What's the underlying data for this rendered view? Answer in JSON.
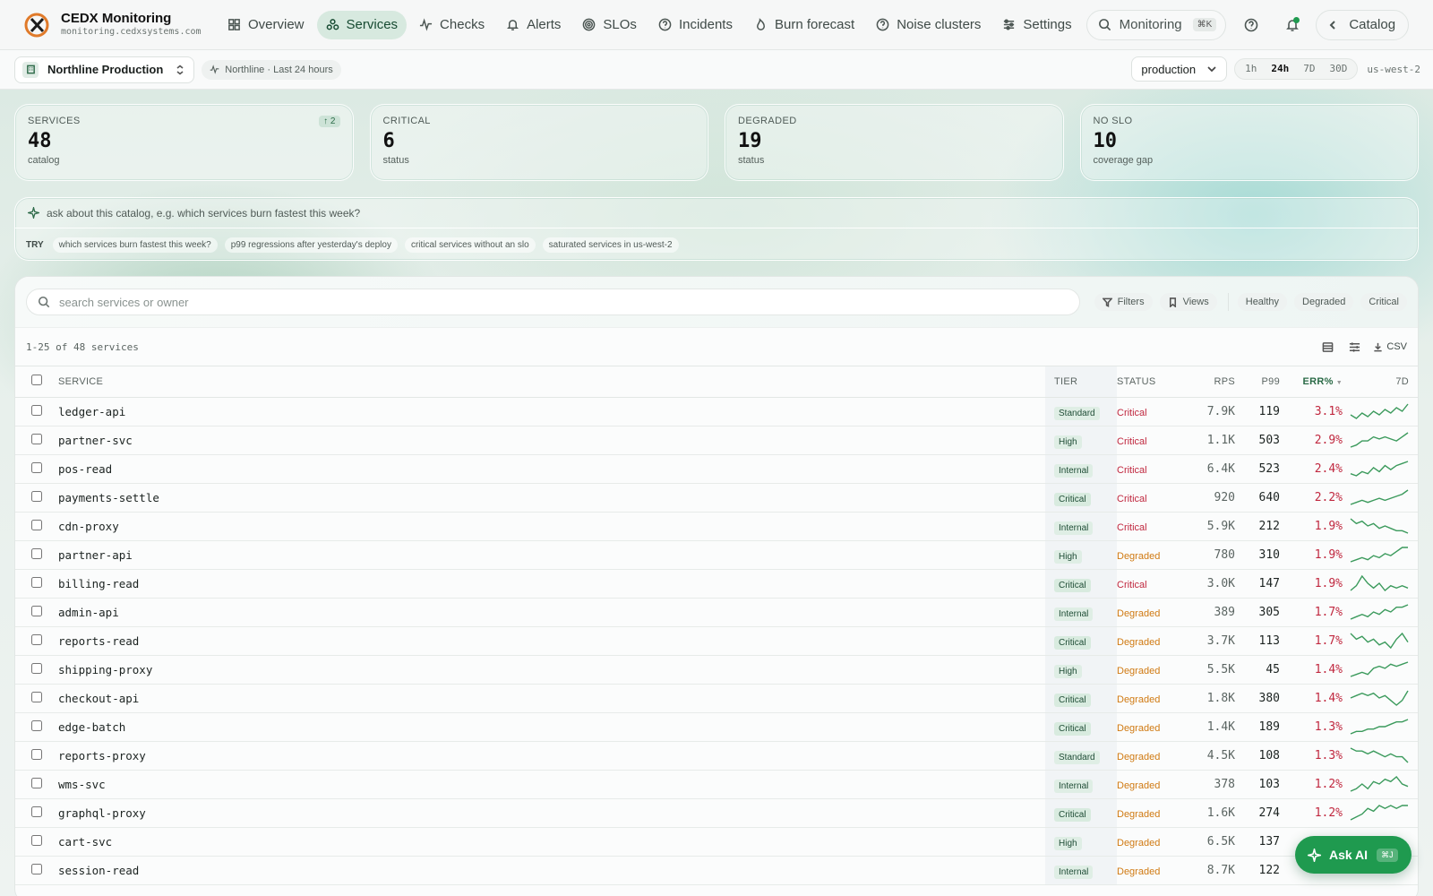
{
  "brand": {
    "title": "CEDX Monitoring",
    "domain": "monitoring.cedxsystems.com"
  },
  "nav": [
    {
      "label": "Overview",
      "icon": "grid-icon"
    },
    {
      "label": "Services",
      "icon": "cluster-icon",
      "active": true
    },
    {
      "label": "Checks",
      "icon": "pulse-icon"
    },
    {
      "label": "Alerts",
      "icon": "bell-icon"
    },
    {
      "label": "SLOs",
      "icon": "target-icon"
    },
    {
      "label": "Incidents",
      "icon": "help-circle-icon"
    },
    {
      "label": "Burn forecast",
      "icon": "flame-icon"
    },
    {
      "label": "Noise clusters",
      "icon": "help-circle-icon"
    },
    {
      "label": "Settings",
      "icon": "sliders-icon"
    }
  ],
  "search": {
    "label": "Monitoring",
    "shortcut": "⌘K"
  },
  "catalog_button": "Catalog",
  "subbar": {
    "org": "Northline Production",
    "context": "Northline · Last 24 hours",
    "environment": "production",
    "ranges": [
      "1h",
      "24h",
      "7D",
      "30D"
    ],
    "active_range": "24h",
    "region": "us-west-2"
  },
  "stats": [
    {
      "label": "SERVICES",
      "value": "48",
      "sub": "catalog",
      "delta": "↑ 2"
    },
    {
      "label": "CRITICAL",
      "value": "6",
      "sub": "status"
    },
    {
      "label": "DEGRADED",
      "value": "19",
      "sub": "status"
    },
    {
      "label": "NO SLO",
      "value": "10",
      "sub": "coverage gap"
    }
  ],
  "ask": {
    "placeholder": "ask about this catalog, e.g. which services burn fastest this week?",
    "try_label": "TRY",
    "suggestions": [
      "which services burn fastest this week?",
      "p99 regressions after yesterday's deploy",
      "critical services without an slo",
      "saturated services in us-west-2"
    ]
  },
  "table_tools": {
    "search_placeholder": "search services or owner",
    "filters": "Filters",
    "views": "Views",
    "status_filters": [
      "Healthy",
      "Degraded",
      "Critical"
    ],
    "count": "1-25 of 48 services",
    "csv": "CSV"
  },
  "columns": {
    "service": "SERVICE",
    "tier": "TIER",
    "status": "STATUS",
    "rps": "RPS",
    "p99": "P99",
    "err": "ERR%",
    "spark": "7D"
  },
  "rows": [
    {
      "service": "ledger-api",
      "tier": "Standard",
      "status": "Critical",
      "rps": "7.9K",
      "p99": "119",
      "err": "3.1%",
      "trend": [
        6,
        4,
        7,
        5,
        8,
        6,
        9,
        7,
        10,
        8,
        12
      ]
    },
    {
      "service": "partner-svc",
      "tier": "High",
      "status": "Critical",
      "rps": "1.1K",
      "p99": "503",
      "err": "2.9%",
      "trend": [
        4,
        5,
        7,
        7,
        9,
        8,
        9,
        8,
        7,
        9,
        11
      ]
    },
    {
      "service": "pos-read",
      "tier": "Internal",
      "status": "Critical",
      "rps": "6.4K",
      "p99": "523",
      "err": "2.4%",
      "trend": [
        5,
        4,
        6,
        5,
        8,
        6,
        9,
        7,
        9,
        10,
        11
      ]
    },
    {
      "service": "payments-settle",
      "tier": "Critical",
      "status": "Critical",
      "rps": "920",
      "p99": "640",
      "err": "2.2%",
      "trend": [
        4,
        5,
        6,
        5,
        6,
        7,
        6,
        7,
        8,
        9,
        11
      ]
    },
    {
      "service": "cdn-proxy",
      "tier": "Internal",
      "status": "Critical",
      "rps": "5.9K",
      "p99": "212",
      "err": "1.9%",
      "trend": [
        11,
        9,
        10,
        8,
        9,
        7,
        8,
        7,
        6,
        6,
        5
      ]
    },
    {
      "service": "partner-api",
      "tier": "High",
      "status": "Degraded",
      "rps": "780",
      "p99": "310",
      "err": "1.9%",
      "trend": [
        4,
        5,
        6,
        5,
        7,
        6,
        8,
        7,
        9,
        11,
        11
      ]
    },
    {
      "service": "billing-read",
      "tier": "Critical",
      "status": "Critical",
      "rps": "3.0K",
      "p99": "147",
      "err": "1.9%",
      "trend": [
        6,
        8,
        12,
        9,
        7,
        9,
        6,
        8,
        7,
        8,
        7
      ]
    },
    {
      "service": "admin-api",
      "tier": "Internal",
      "status": "Degraded",
      "rps": "389",
      "p99": "305",
      "err": "1.7%",
      "trend": [
        5,
        6,
        7,
        6,
        8,
        7,
        9,
        8,
        10,
        10,
        11
      ]
    },
    {
      "service": "reports-read",
      "tier": "Critical",
      "status": "Degraded",
      "rps": "3.7K",
      "p99": "113",
      "err": "1.7%",
      "trend": [
        11,
        9,
        10,
        8,
        9,
        7,
        8,
        6,
        9,
        11,
        8
      ]
    },
    {
      "service": "shipping-proxy",
      "tier": "High",
      "status": "Degraded",
      "rps": "5.5K",
      "p99": "45",
      "err": "1.4%",
      "trend": [
        4,
        5,
        6,
        5,
        8,
        9,
        8,
        10,
        9,
        10,
        11
      ]
    },
    {
      "service": "checkout-api",
      "tier": "Critical",
      "status": "Degraded",
      "rps": "1.8K",
      "p99": "380",
      "err": "1.4%",
      "trend": [
        8,
        9,
        10,
        9,
        10,
        8,
        9,
        7,
        5,
        7,
        11
      ]
    },
    {
      "service": "edge-batch",
      "tier": "Critical",
      "status": "Degraded",
      "rps": "1.4K",
      "p99": "189",
      "err": "1.3%",
      "trend": [
        4,
        5,
        5,
        6,
        6,
        7,
        7,
        8,
        9,
        9,
        10
      ]
    },
    {
      "service": "reports-proxy",
      "tier": "Standard",
      "status": "Degraded",
      "rps": "4.5K",
      "p99": "108",
      "err": "1.3%",
      "trend": [
        10,
        9,
        9,
        8,
        9,
        8,
        7,
        8,
        7,
        7,
        5
      ]
    },
    {
      "service": "wms-svc",
      "tier": "Internal",
      "status": "Degraded",
      "rps": "378",
      "p99": "103",
      "err": "1.2%",
      "trend": [
        5,
        6,
        8,
        6,
        9,
        8,
        10,
        9,
        11,
        8,
        7
      ]
    },
    {
      "service": "graphql-proxy",
      "tier": "Critical",
      "status": "Degraded",
      "rps": "1.6K",
      "p99": "274",
      "err": "1.2%",
      "trend": [
        4,
        5,
        6,
        8,
        7,
        9,
        8,
        9,
        8,
        9,
        9
      ]
    },
    {
      "service": "cart-svc",
      "tier": "High",
      "status": "Degraded",
      "rps": "6.5K",
      "p99": "137",
      "err": "",
      "trend": []
    },
    {
      "service": "session-read",
      "tier": "Internal",
      "status": "Degraded",
      "rps": "8.7K",
      "p99": "122",
      "err": "",
      "trend": []
    }
  ],
  "ask_ai": {
    "label": "Ask AI",
    "shortcut": "⌘J"
  },
  "colors": {
    "accent": "#1f9a4f",
    "critical": "#c0283f",
    "degraded": "#d07a12",
    "nav_active_bg": "#d7e9df"
  }
}
